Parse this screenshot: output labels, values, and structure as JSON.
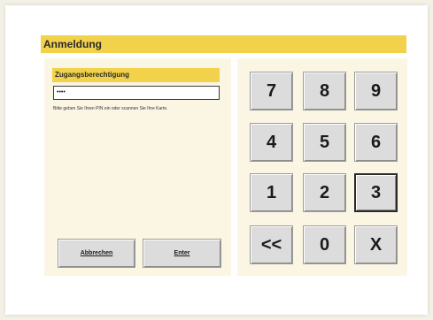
{
  "header": {
    "title": "Anmeldung"
  },
  "login": {
    "section_title": "Zugangsberechtigung",
    "pin_value": "••••",
    "hint": "Bitte geben Sie Ihren PIN ein oder scannen Sie Ihre Karte.",
    "cancel_label": "Abbrechen",
    "enter_label": "Enter"
  },
  "keypad": {
    "keys": [
      "7",
      "8",
      "9",
      "4",
      "5",
      "6",
      "1",
      "2",
      "3",
      "<<",
      "0",
      "X"
    ],
    "selected_key": "3"
  },
  "colors": {
    "accent": "#f2d24a",
    "panel": "#fbf6e4",
    "button": "#dcdcdc"
  }
}
